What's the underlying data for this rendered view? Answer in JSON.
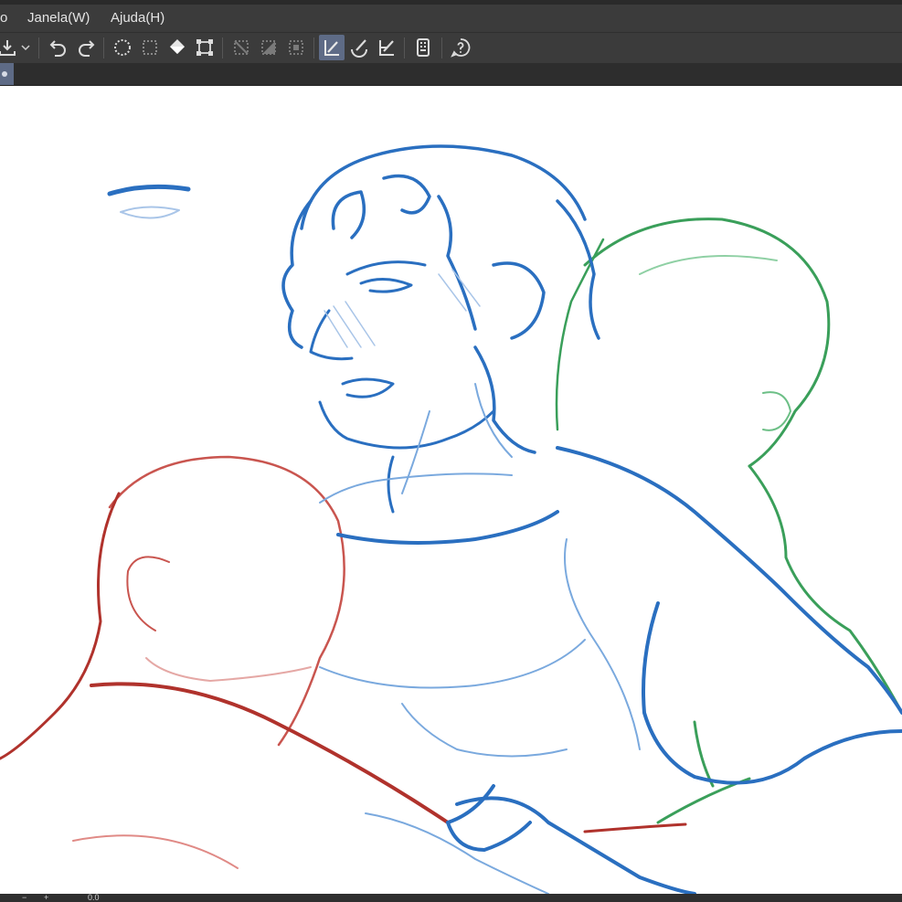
{
  "menu": {
    "cut_label": "o",
    "window_label": "Janela(W)",
    "help_label": "Ajuda(H)"
  },
  "toolbar": {
    "items": [
      "save-icon",
      "dropdown-chevron-icon",
      "undo-icon",
      "redo-icon",
      "select-all-icon",
      "deselect-icon",
      "fill-icon",
      "transform-icon",
      "hide-selection-icon",
      "invert-selection-icon",
      "crop-selection-icon",
      "snap-to-ruler-icon",
      "snap-to-special-ruler-icon",
      "snap-to-grid-icon",
      "companion-mode-icon",
      "help-icon"
    ]
  },
  "status": {
    "minus": "−",
    "plus": "+",
    "zoom_value": "0.0"
  },
  "colors": {
    "chrome": "#3b3b3b",
    "active_tool": "#5e6b86",
    "sketch_blue": "#2a6fc0",
    "sketch_green": "#3a9f5a",
    "sketch_red": "#b0322c"
  }
}
